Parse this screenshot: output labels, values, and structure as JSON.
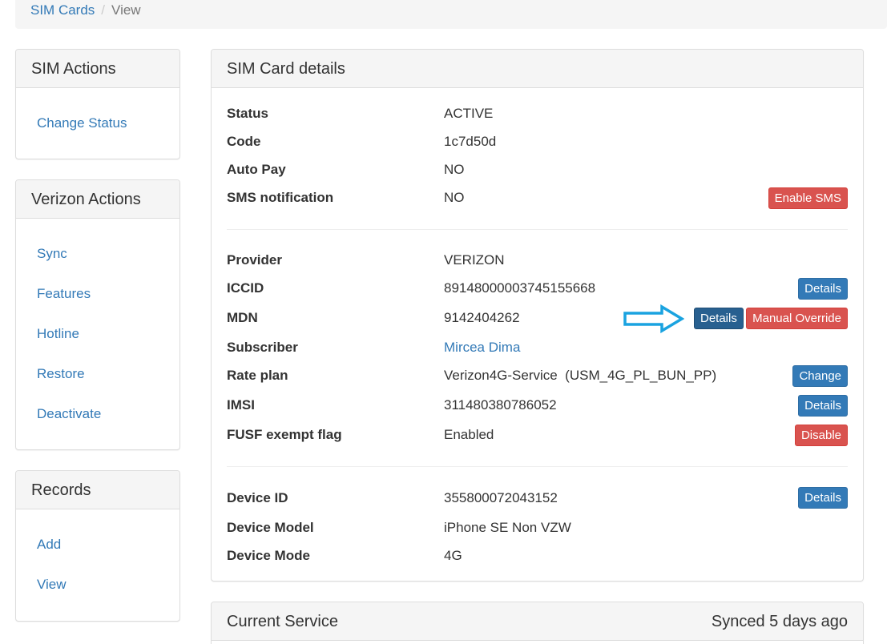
{
  "breadcrumb": {
    "parent": "SIM Cards",
    "separator": "/",
    "current": "View"
  },
  "sidebar": {
    "sim_actions": {
      "title": "SIM Actions",
      "items": [
        "Change Status"
      ]
    },
    "verizon_actions": {
      "title": "Verizon Actions",
      "items": [
        "Sync",
        "Features",
        "Hotline",
        "Restore",
        "Deactivate"
      ]
    },
    "records": {
      "title": "Records",
      "items": [
        "Add",
        "View"
      ]
    }
  },
  "details": {
    "title": "SIM Card details",
    "status": {
      "label": "Status",
      "value": "ACTIVE"
    },
    "code": {
      "label": "Code",
      "value": "1c7d50d"
    },
    "auto_pay": {
      "label": "Auto Pay",
      "value": "NO"
    },
    "sms": {
      "label": "SMS notification",
      "value": "NO",
      "button": "Enable SMS"
    },
    "provider": {
      "label": "Provider",
      "value": "VERIZON"
    },
    "iccid": {
      "label": "ICCID",
      "value": "89148000003745155668",
      "button": "Details"
    },
    "mdn": {
      "label": "MDN",
      "value": "9142404262",
      "button": "Details",
      "button2": "Manual Override"
    },
    "subscriber": {
      "label": "Subscriber",
      "value": "Mircea Dima"
    },
    "rate_plan": {
      "label": "Rate plan",
      "value": "Verizon4G-Service  (USM_4G_PL_BUN_PP)",
      "button": "Change"
    },
    "imsi": {
      "label": "IMSI",
      "value": "311480380786052",
      "button": "Details"
    },
    "fusf": {
      "label": "FUSF exempt flag",
      "value": "Enabled",
      "button": "Disable"
    },
    "device_id": {
      "label": "Device ID",
      "value": "355800072043152",
      "button": "Details"
    },
    "device_model": {
      "label": "Device Model",
      "value": "iPhone SE Non VZW"
    },
    "device_mode": {
      "label": "Device Mode",
      "value": "4G"
    }
  },
  "current_service": {
    "title": "Current Service",
    "synced": "Synced 5 days ago"
  },
  "icons": {
    "annotation_arrow": "right-arrow-icon"
  },
  "colors": {
    "link": "#337ab7",
    "primary": "#337ab7",
    "danger": "#d9534f",
    "arrow": "#1aa3e0"
  }
}
